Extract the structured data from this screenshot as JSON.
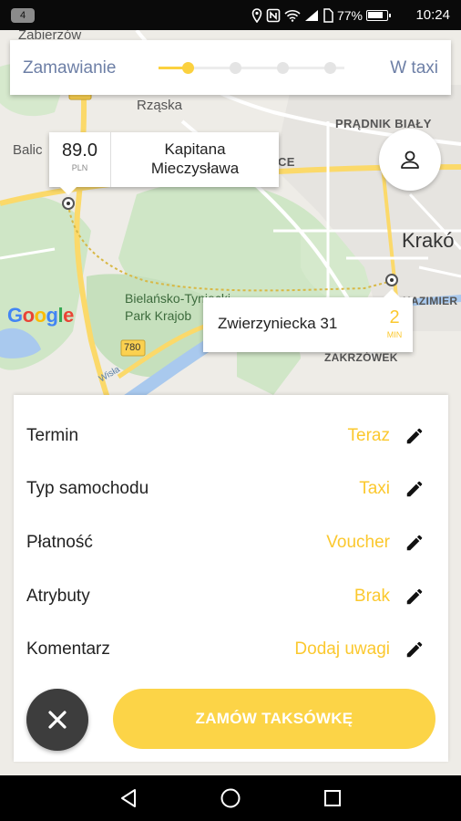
{
  "status_bar": {
    "notification_count": "4",
    "battery": "77%",
    "time": "10:24"
  },
  "progress": {
    "start_label": "Zamawianie",
    "end_label": "W taxi",
    "step_count": 4,
    "current_step": 1
  },
  "map": {
    "labels": {
      "zabierzow": "Zabierzów",
      "rzaska": "Rząska",
      "balice": "Balic",
      "pradnik": "PRĄDNIK BIAŁY",
      "krakow": "Krakó",
      "bielany_1": "Bielańsko-Tyniecki",
      "bielany_2": "Park Krajob",
      "kazimierz": "KAZIMIER",
      "zakrzowek": "ZAKRZÓWEK",
      "road_780": "780",
      "road_774": "774",
      "wisla": "Wisła",
      "ce_fragment": "CE"
    },
    "google_logo": "Google",
    "accent_color": "#fbc82e"
  },
  "pickup": {
    "price": "89.0",
    "currency": "PLN",
    "address_line1": "Kapitana",
    "address_line2": "Mieczysława"
  },
  "destination": {
    "address": "Zwierzyniecka 31",
    "eta": "2",
    "eta_unit": "MIN"
  },
  "options": [
    {
      "label": "Termin",
      "value": "Teraz",
      "icon": "pencil-icon"
    },
    {
      "label": "Typ samochodu",
      "value": "Taxi",
      "icon": "pencil-icon"
    },
    {
      "label": "Płatność",
      "value": "Voucher",
      "icon": "pencil-icon"
    },
    {
      "label": "Atrybuty",
      "value": "Brak",
      "icon": "pencil-icon"
    },
    {
      "label": "Komentarz",
      "value": "Dodaj uwagi",
      "icon": "pencil-icon"
    }
  ],
  "actions": {
    "cancel_icon": "close-icon",
    "order_label": "ZAMÓW TAKSÓWKĘ",
    "order_color": "#fcd447"
  },
  "nav": [
    "back-icon",
    "home-icon",
    "recents-icon"
  ]
}
